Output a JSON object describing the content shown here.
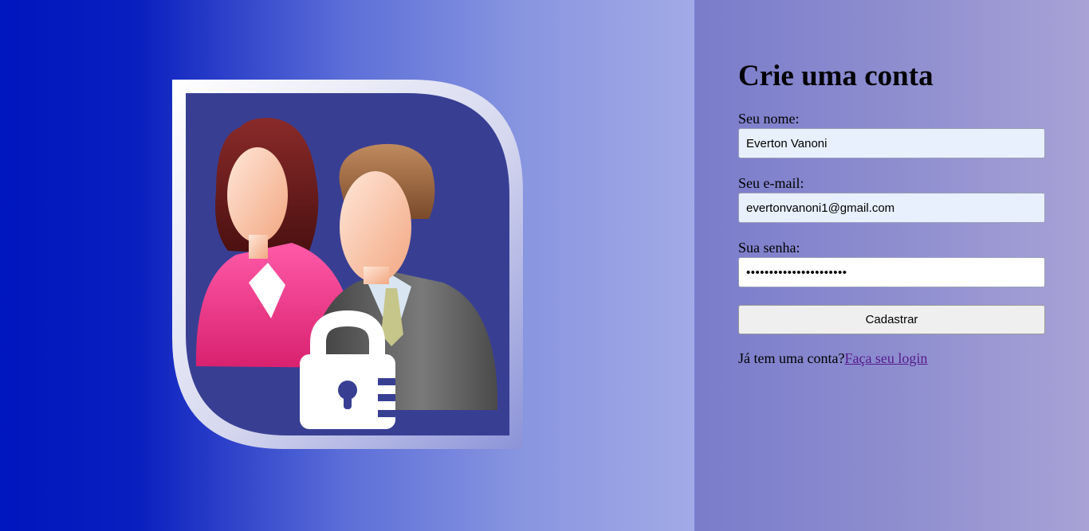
{
  "signup": {
    "title": "Crie uma conta",
    "name_label": "Seu nome:",
    "name_value": "Everton Vanoni",
    "email_label": "Seu e-mail:",
    "email_value": "evertonvanoni1@gmail.com",
    "password_label": "Sua senha:",
    "password_value": "••••••••••••••••••••••",
    "submit_label": "Cadastrar",
    "login_prompt": "Já tem uma conta?",
    "login_link": "Faça seu login"
  },
  "illustration": {
    "icon": "users-lock-icon",
    "tile_color": "#383f93",
    "woman_jacket_color": "#e8348a",
    "man_suit_color": "#5a5a5a"
  },
  "colors": {
    "left_gradient_start": "#0016be",
    "left_gradient_end": "#a3aae6",
    "right_gradient_start": "#7a7ccb",
    "right_gradient_end": "#a8a2d6",
    "link": "#551a8b"
  }
}
